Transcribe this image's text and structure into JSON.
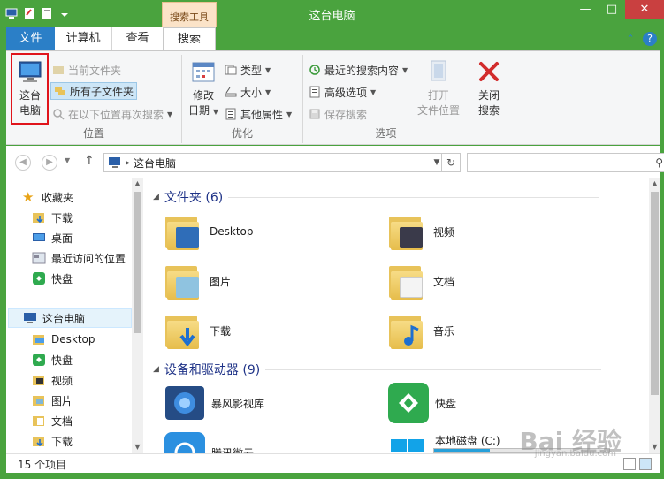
{
  "window": {
    "title": "这台电脑",
    "tool_tab": "搜索工具"
  },
  "tabs": {
    "file": "文件",
    "computer": "计算机",
    "view": "查看",
    "search": "搜索"
  },
  "ribbon": {
    "location_group": {
      "label": "位置",
      "this_pc_line1": "这台",
      "this_pc_line2": "电脑",
      "current_folder": "当前文件夹",
      "all_subfolders": "所有子文件夹",
      "search_again_in": "在以下位置再次搜索"
    },
    "refine_group": {
      "label": "优化",
      "modified_line1": "修改",
      "modified_line2": "日期",
      "type": "类型",
      "size": "大小",
      "other_props": "其他属性"
    },
    "options_group": {
      "label": "选项",
      "recent_searches": "最近的搜索内容",
      "advanced_options": "高级选项",
      "save_search": "保存搜索",
      "open_location_line1": "打开",
      "open_location_line2": "文件位置"
    },
    "close_group": {
      "close_line1": "关闭",
      "close_line2": "搜索"
    }
  },
  "address": {
    "path": "这台电脑"
  },
  "nav_pane": {
    "favorites": "收藏夹",
    "fav_items": [
      "下载",
      "桌面",
      "最近访问的位置",
      "快盘"
    ],
    "this_pc": "这台电脑",
    "pc_items": [
      "Desktop",
      "快盘",
      "视频",
      "图片",
      "文档",
      "下载"
    ]
  },
  "main": {
    "folders_header": "文件夹 (6)",
    "folders": [
      "Desktop",
      "视频",
      "图片",
      "文档",
      "下载",
      "音乐"
    ],
    "devices_header": "设备和驱动器 (9)",
    "devices": [
      "暴风影视库",
      "快盘",
      "腾讯微云",
      "本地磁盘 (C:)"
    ]
  },
  "status": {
    "count": "15 个项目"
  },
  "watermark": {
    "text": "Bai 经验",
    "sub": "jingyan.baidu.com"
  },
  "colors": {
    "titlebar": "#4aa33e",
    "file_tab": "#2b7fc7",
    "tool_tab": "#fbe3c8",
    "highlight": "#e0141b",
    "section_header": "#1e3287"
  }
}
